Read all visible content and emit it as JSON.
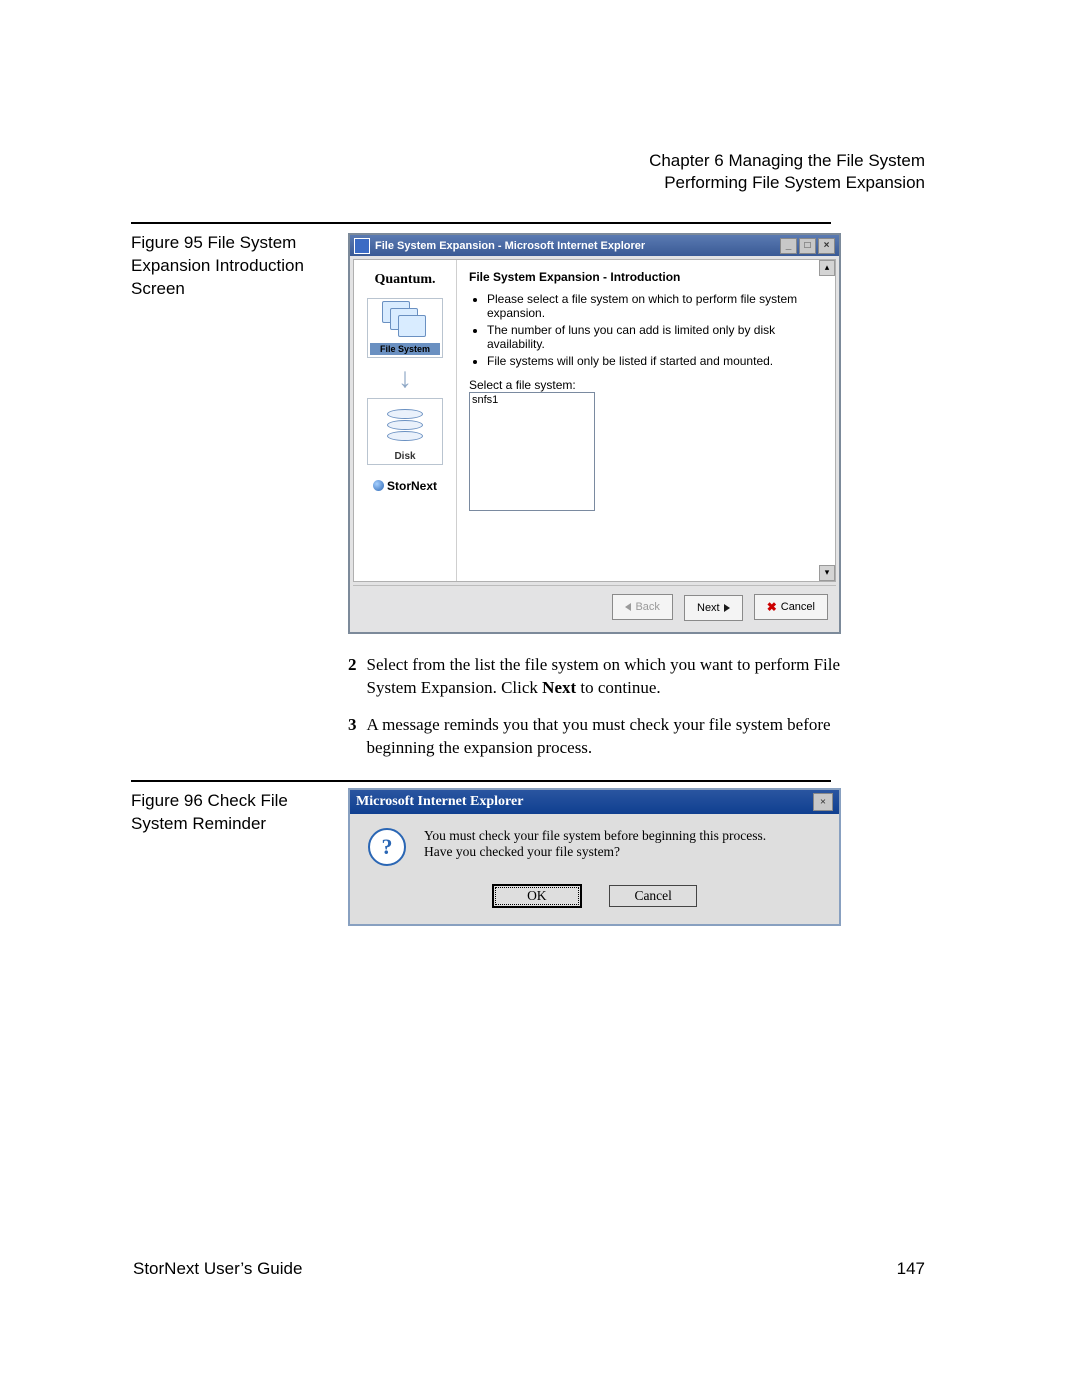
{
  "header": {
    "chapter": "Chapter 6  Managing the File System",
    "section": "Performing File System Expansion"
  },
  "fig1": {
    "caption": "Figure 95  File System Expansion Introduction Screen"
  },
  "fig2": {
    "caption": "Figure 96  Check File System Reminder"
  },
  "ie": {
    "title": "File System Expansion - Microsoft Internet Explorer",
    "heading": "File System Expansion - Introduction",
    "bullets": [
      "Please select a file system on which to perform file system expansion.",
      "The number of luns you can add is limited only by disk availability.",
      "File systems will only be listed if started and mounted."
    ],
    "select_label": "Select a file system:",
    "options": [
      "snfs1"
    ],
    "sidebar": {
      "brand": "Quantum.",
      "fs_label": "File System",
      "disk_label": "Disk",
      "product": "StorNext"
    },
    "buttons": {
      "back": "Back",
      "next": "Next",
      "cancel": "Cancel"
    }
  },
  "steps": {
    "s2": {
      "num": "2",
      "text_a": "Select from the list the file system on which you want to perform File System Expansion. Click ",
      "bold": "Next",
      "text_b": " to continue."
    },
    "s3": {
      "num": "3",
      "text": "A message reminds you that you must check your file system before beginning the expansion process."
    }
  },
  "msg": {
    "title": "Microsoft Internet Explorer",
    "line1": "You must check your file system before beginning this process.",
    "line2": "Have you checked your file system?",
    "ok": "OK",
    "cancel": "Cancel"
  },
  "footer": {
    "guide": "StorNext User’s Guide",
    "page": "147"
  }
}
